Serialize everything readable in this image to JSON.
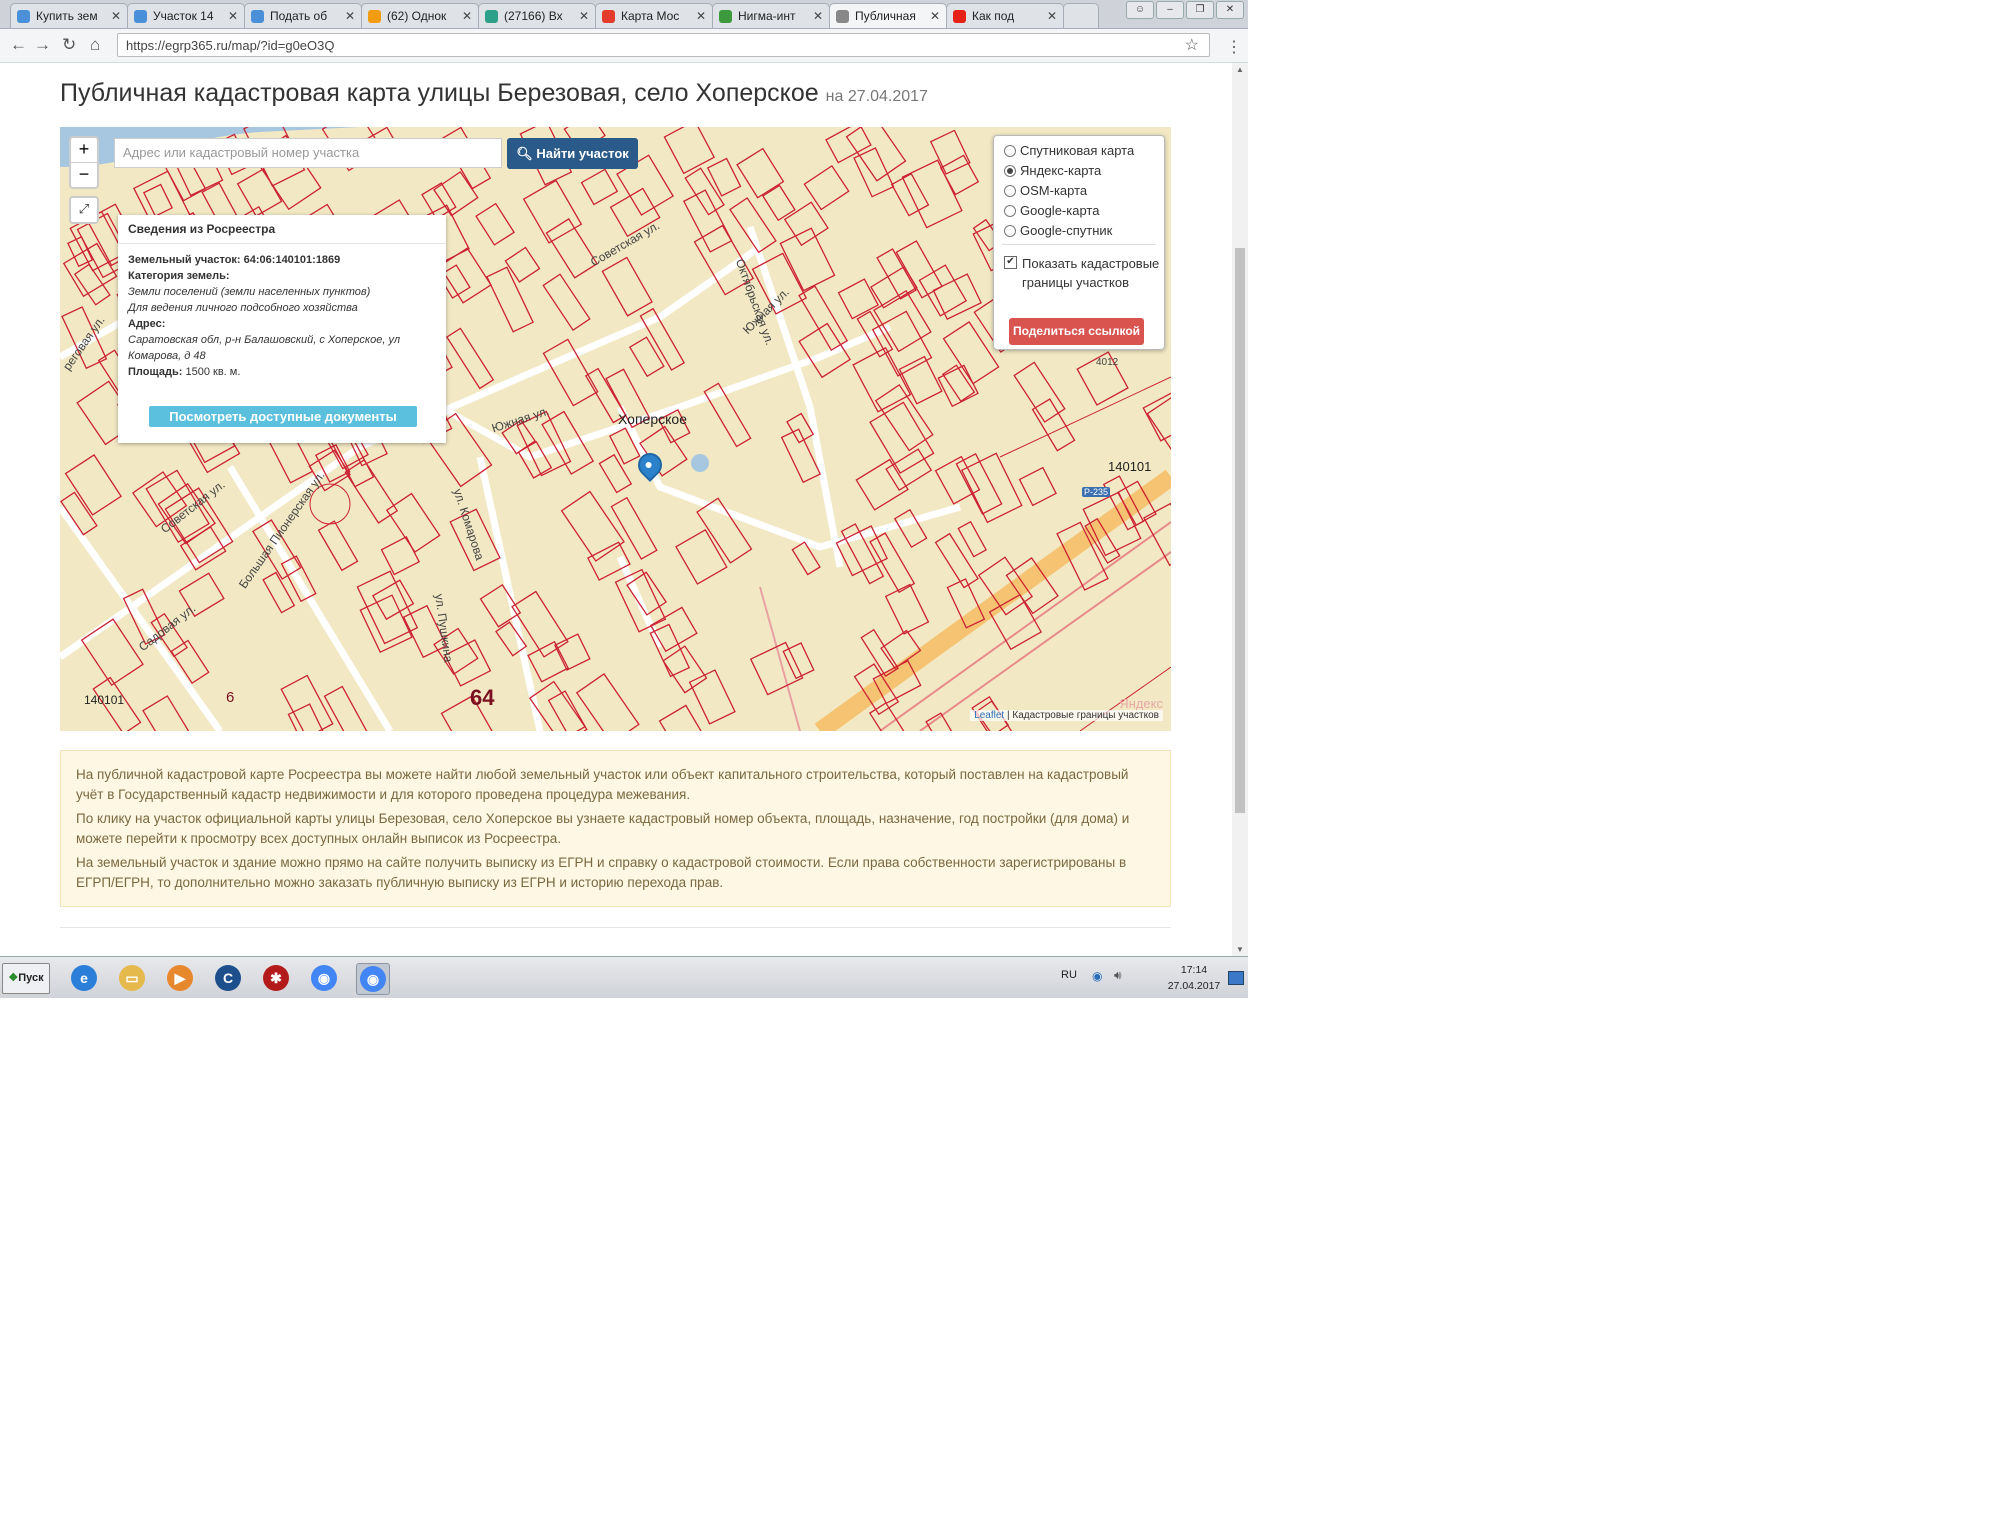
{
  "browser": {
    "tabs": [
      {
        "label": "Купить зем",
        "color": "#4a90d9"
      },
      {
        "label": "Участок 14",
        "color": "#4a90d9"
      },
      {
        "label": "Подать об",
        "color": "#4a90d9"
      },
      {
        "label": "(62) Однок",
        "color": "#f39c12"
      },
      {
        "label": "(27166) Вх",
        "color": "#2ca089"
      },
      {
        "label": "Карта Мос",
        "color": "#e43b2c"
      },
      {
        "label": "Нигма-инт",
        "color": "#3c9a3c"
      },
      {
        "label": "Публичная",
        "color": "#888888"
      },
      {
        "label": "Как под",
        "color": "#e62117"
      }
    ],
    "active_tab_index": 7,
    "url": "https://egrp365.ru/map/?id=g0eO3Q"
  },
  "page": {
    "title": "Публичная кадастровая карта улицы Березовая, село Хоперское",
    "date": "на 27.04.2017"
  },
  "map": {
    "search_placeholder": "Адрес или кадастровый номер участка",
    "search_button": "Найти участок",
    "zoom_in": "+",
    "zoom_out": "−",
    "popup": {
      "header": "Сведения из Росреестра",
      "parcel_label": "Земельный участок: 64:06:140101:1869",
      "category_label": "Категория земель:",
      "category_value": "Земли поселений (земли населенных пунктов)",
      "use_value": "Для ведения личного подсобного хозяйства",
      "address_label": "Адрес:",
      "address_value": "Саратовская обл, р-н Балашовский, с Хоперское, ул Комарова, д 48",
      "area_label": "Площадь:",
      "area_value": "1500 кв. м.",
      "docs_button": "Посмотреть доступные документы"
    },
    "layers": {
      "options": [
        {
          "label": "Спутниковая карта",
          "selected": false
        },
        {
          "label": "Яндекс-карта",
          "selected": true
        },
        {
          "label": "OSM-карта",
          "selected": false
        },
        {
          "label": "Google-карта",
          "selected": false
        },
        {
          "label": "Google-спутник",
          "selected": false
        }
      ],
      "show_cadastral": "Показать кадастровые границы участков",
      "show_cadastral_checked": true,
      "share_button": "Поделиться ссылкой"
    },
    "labels": {
      "village": "Хоперское",
      "quarter_right": "140101",
      "quarter_left": "140101",
      "region_big": "64",
      "region_small": "6",
      "road": "Р-235",
      "num_4012": "4012",
      "street_sovetskaya": "Советская ул.",
      "street_yuzhnaya": "Южная ул.",
      "street_komarova": "ул. Комарова",
      "street_pushkina": "ул. Пушкина",
      "street_pionerskaya": "Большая Пионерская ул.",
      "street_sovetskaya2": "Советская ул.",
      "street_oktyabrskaya": "Октябрьская ул.",
      "street_yuzhnaya2": "Южная ул.",
      "street_sadovaya": "Садовая ул.",
      "street_left": "реговая ул."
    },
    "attribution_leaflet": "Leaflet",
    "attribution_text": "| Кадастровые границы участков",
    "watermark": "Яндекс"
  },
  "info": {
    "p1": "На публичной кадастровой карте Росреестра вы можете найти любой земельный участок или объект капитального строительства, который поставлен на кадастровый учёт в Государственный кадастр недвижимости и для которого проведена процедура межевания.",
    "p2": "По клику на участок официальной карты улицы Березовая, село Хоперское вы узнаете кадастровый номер объекта, площадь, назначение, год постройки (для дома) и можете перейти к просмотру всех доступных онлайн выписок из Росреестра.",
    "p3": "На земельный участок и здание можно прямо на сайте получить выписку из ЕГРН и справку о кадастровой стоимости. Если права собственности зарегистрированы в ЕГРП/ЕГРН, то дополнительно можно заказать публичную выписку из ЕГРН и историю перехода прав."
  },
  "taskbar": {
    "start": "Пуск",
    "lang": "RU",
    "time": "17:14",
    "date": "27.04.2017",
    "apps": [
      {
        "name": "ie-icon",
        "color": "#2c7fd8",
        "glyph": "e"
      },
      {
        "name": "folder-icon",
        "color": "#e5b94b",
        "glyph": "▭"
      },
      {
        "name": "media-player-icon",
        "color": "#e8882c",
        "glyph": "▶"
      },
      {
        "name": "ccleaner-icon",
        "color": "#1c4f8c",
        "glyph": "C"
      },
      {
        "name": "antivirus-icon",
        "color": "#b31b1b",
        "glyph": "✱"
      },
      {
        "name": "chrome-icon",
        "color": "#4285f4",
        "glyph": "◉"
      },
      {
        "name": "chrome-active-icon",
        "color": "#4285f4",
        "glyph": "◉"
      }
    ]
  }
}
